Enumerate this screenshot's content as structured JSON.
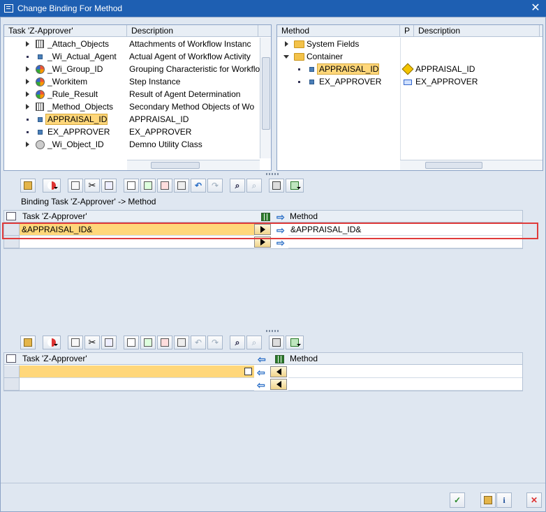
{
  "window": {
    "title": "Change Binding For Method"
  },
  "task_tree": {
    "columns": [
      "Task 'Z-Approver'",
      "Description"
    ],
    "rows": [
      {
        "name": "_Attach_Objects",
        "desc": "Attachments of Workflow Instanc",
        "icon": "table-icon",
        "expand": true
      },
      {
        "name": "_Wi_Actual_Agent",
        "desc": "Actual Agent of Workflow Activity",
        "icon": "element-icon",
        "expand": false
      },
      {
        "name": "_Wi_Group_ID",
        "desc": "Grouping Characteristic for Workflo",
        "icon": "structure-icon",
        "expand": true
      },
      {
        "name": "_Workitem",
        "desc": "Step Instance",
        "icon": "structure-icon",
        "expand": true
      },
      {
        "name": "_Rule_Result",
        "desc": "Result of Agent Determination",
        "icon": "structure-icon",
        "expand": true
      },
      {
        "name": "_Method_Objects",
        "desc": "Secondary Method Objects of Wo",
        "icon": "table-icon",
        "expand": true
      },
      {
        "name": "APPRAISAL_ID",
        "desc": "APPRAISAL_ID",
        "icon": "element-icon",
        "expand": false,
        "selected": true
      },
      {
        "name": "EX_APPROVER",
        "desc": "EX_APPROVER",
        "icon": "element-icon",
        "expand": false
      },
      {
        "name": "_Wi_Object_ID",
        "desc": "Demno Utility Class",
        "icon": "object-icon",
        "expand": true
      }
    ]
  },
  "method_tree": {
    "columns": [
      "Method",
      "P",
      "Description"
    ],
    "rows": [
      {
        "name": "System Fields",
        "p_icon": "",
        "desc": "",
        "icon": "folder-icon",
        "level": 0,
        "state": "collapsed"
      },
      {
        "name": "Container",
        "p_icon": "",
        "desc": "",
        "icon": "folder-icon",
        "level": 0,
        "state": "expanded"
      },
      {
        "name": "APPRAISAL_ID",
        "p_icon": "warning-icon",
        "desc": "APPRAISAL_ID",
        "icon": "element-icon",
        "level": 1,
        "selected": true
      },
      {
        "name": "EX_APPROVER",
        "p_icon": "import-icon",
        "desc": "EX_APPROVER",
        "icon": "element-icon",
        "level": 1
      }
    ]
  },
  "binding_section": {
    "title": "Binding Task 'Z-Approver' -> Method",
    "col_left": "Task 'Z-Approver'",
    "col_right": "Method",
    "rows": [
      {
        "left": "&APPRAISAL_ID&",
        "right": "&APPRAISAL_ID&"
      },
      {
        "left": "",
        "right": ""
      }
    ]
  },
  "reverse_section": {
    "col_left": "Task 'Z-Approver'",
    "col_right": "Method",
    "rows": [
      {
        "left": "",
        "right": ""
      },
      {
        "left": "",
        "right": ""
      }
    ]
  },
  "colors": {
    "title_bar": "#1e5fb2",
    "selection": "#ffd77a",
    "highlight": "#e03b3b"
  }
}
